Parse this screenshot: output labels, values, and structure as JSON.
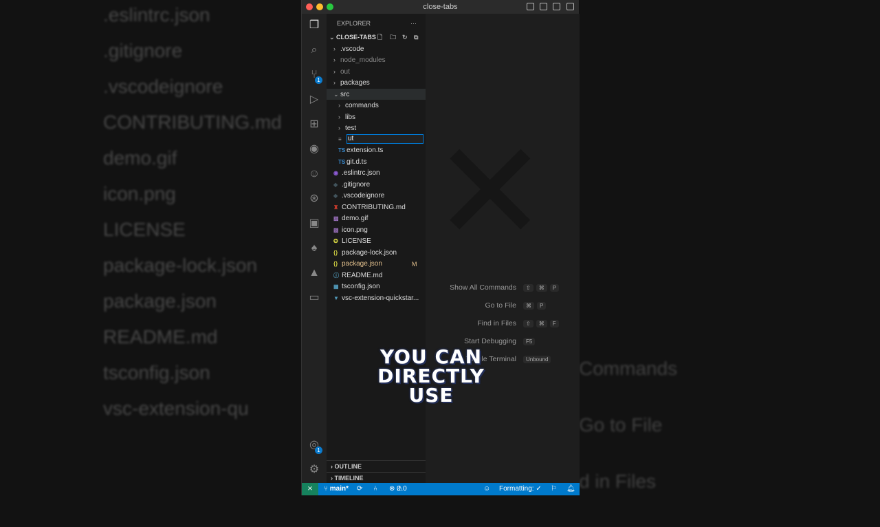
{
  "window": {
    "title": "close-tabs"
  },
  "explorer": {
    "header": "EXPLORER",
    "more": "···",
    "root": "CLOSE-TABS",
    "items": [
      {
        "label": ".vscode",
        "type": "folder",
        "depth": 0,
        "open": false,
        "color": "#ddd"
      },
      {
        "label": "node_modules",
        "type": "folder",
        "depth": 0,
        "open": false,
        "color": "#888"
      },
      {
        "label": "out",
        "type": "folder",
        "depth": 0,
        "open": false,
        "color": "#888"
      },
      {
        "label": "packages",
        "type": "folder",
        "depth": 0,
        "open": false,
        "color": "#ddd"
      },
      {
        "label": "src",
        "type": "folder",
        "depth": 0,
        "open": true,
        "color": "#ddd"
      },
      {
        "label": "commands",
        "type": "folder",
        "depth": 1,
        "open": false,
        "color": "#ddd"
      },
      {
        "label": "libs",
        "type": "folder",
        "depth": 1,
        "open": false,
        "color": "#ddd"
      },
      {
        "label": "test",
        "type": "folder",
        "depth": 1,
        "open": false,
        "color": "#ddd"
      },
      {
        "label": "ut",
        "type": "input",
        "depth": 1,
        "color": "#fff"
      },
      {
        "label": "extension.ts",
        "type": "ts",
        "depth": 1,
        "color": "#ddd"
      },
      {
        "label": "git.d.ts",
        "type": "ts",
        "depth": 1,
        "color": "#ddd"
      },
      {
        "label": ".eslintrc.json",
        "type": "eslint",
        "depth": 0,
        "color": "#ddd"
      },
      {
        "label": ".gitignore",
        "type": "git",
        "depth": 0,
        "color": "#ddd"
      },
      {
        "label": ".vscodeignore",
        "type": "git",
        "depth": 0,
        "color": "#ddd"
      },
      {
        "label": "CONTRIBUTING.md",
        "type": "contrib",
        "depth": 0,
        "color": "#ddd"
      },
      {
        "label": "demo.gif",
        "type": "img",
        "depth": 0,
        "color": "#ddd"
      },
      {
        "label": "icon.png",
        "type": "img",
        "depth": 0,
        "color": "#ddd"
      },
      {
        "label": "LICENSE",
        "type": "license",
        "depth": 0,
        "color": "#ddd"
      },
      {
        "label": "package-lock.json",
        "type": "json",
        "depth": 0,
        "color": "#ddd"
      },
      {
        "label": "package.json",
        "type": "json",
        "depth": 0,
        "color": "#e2c08d",
        "badge": "M"
      },
      {
        "label": "README.md",
        "type": "info",
        "depth": 0,
        "color": "#ddd"
      },
      {
        "label": "tsconfig.json",
        "type": "tsconf",
        "depth": 0,
        "color": "#ddd"
      },
      {
        "label": "vsc-extension-quickstar...",
        "type": "down",
        "depth": 0,
        "color": "#ddd"
      }
    ],
    "outline": "OUTLINE",
    "timeline": "TIMELINE"
  },
  "activity": {
    "scm_badge": "1",
    "accounts_badge": "1"
  },
  "shortcuts": [
    {
      "label": "Show All Commands",
      "keys": [
        "⇧",
        "⌘",
        "P"
      ]
    },
    {
      "label": "Go to File",
      "keys": [
        "⌘",
        "P"
      ]
    },
    {
      "label": "Find in Files",
      "keys": [
        "⇧",
        "⌘",
        "F"
      ]
    },
    {
      "label": "Start Debugging",
      "keys": [
        "F5"
      ]
    },
    {
      "label": "Toggle Terminal",
      "keys": [
        "Unbound"
      ]
    }
  ],
  "status": {
    "branch": "main*",
    "errors": "0",
    "warnings": "0",
    "formatting": "Formatting: ✓"
  },
  "caption": {
    "line1": "YOU CAN DIRECTLY",
    "line2": "USE"
  },
  "background_left": [
    ".eslintrc.json",
    ".gitignore",
    ".vscodeignore",
    "CONTRIBUTING.md",
    "demo.gif",
    "icon.png",
    "LICENSE",
    "package-lock.json",
    "package.json",
    "README.md",
    "tsconfig.json",
    "vsc-extension-qu"
  ],
  "background_right": [
    "Commands",
    "Go to File",
    "d in Files"
  ]
}
